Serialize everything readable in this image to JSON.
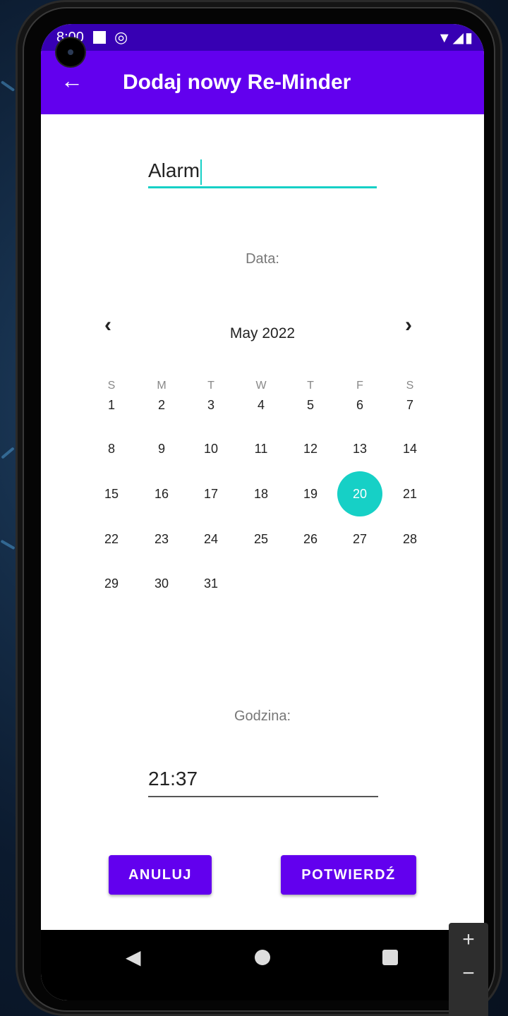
{
  "status": {
    "time": "8:00",
    "right_icons": "▼◢▮"
  },
  "appbar": {
    "back_icon": "←",
    "title": "Dodaj nowy Re-Minder"
  },
  "title_field": {
    "value": "Alarm"
  },
  "date_label": "Data:",
  "calendar": {
    "month": "May 2022",
    "prev_icon": "‹",
    "next_icon": "›",
    "weekdays": [
      "S",
      "M",
      "T",
      "W",
      "T",
      "F",
      "S"
    ],
    "selected_day": "20",
    "weeks": [
      [
        "1",
        "2",
        "3",
        "4",
        "5",
        "6",
        "7"
      ],
      [
        "8",
        "9",
        "10",
        "11",
        "12",
        "13",
        "14"
      ],
      [
        "15",
        "16",
        "17",
        "18",
        "19",
        "20",
        "21"
      ],
      [
        "22",
        "23",
        "24",
        "25",
        "26",
        "27",
        "28"
      ],
      [
        "29",
        "30",
        "31"
      ]
    ]
  },
  "time_label": "Godzina:",
  "time_field": {
    "value": "21:37"
  },
  "buttons": {
    "cancel": "ANULUJ",
    "confirm": "POTWIERDŹ"
  },
  "navbar": {
    "back": "◀"
  },
  "zoom": {
    "plus": "+",
    "minus": "−"
  },
  "colors": {
    "primary": "#6200ee",
    "primary_dark": "#3700b3",
    "accent": "#16d0c6"
  }
}
